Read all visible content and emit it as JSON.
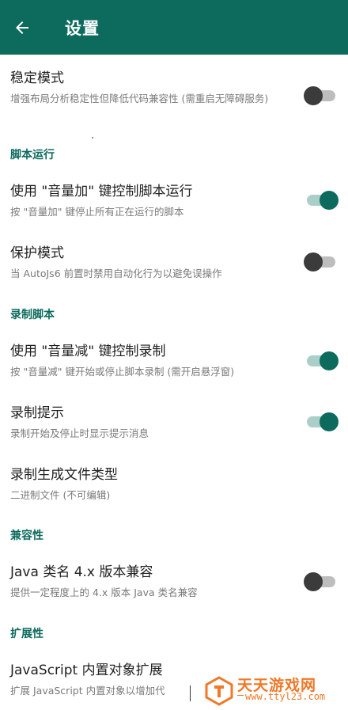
{
  "appbar": {
    "title": "设置",
    "back_icon": "arrow-left-icon",
    "color": "#0d6b5e"
  },
  "items": {
    "stable_mode": {
      "title": "稳定模式",
      "summary": "增强布局分析稳定性但降低代码兼容性 (需重启无障碍服务)",
      "checked": false
    },
    "cat_script_run": "脚本运行",
    "volume_up": {
      "title": "使用 \"音量加\" 键控制脚本运行",
      "summary": "按 \"音量加\" 键停止所有正在运行的脚本",
      "checked": true
    },
    "protect_mode": {
      "title": "保护模式",
      "summary": "当 AutoJs6 前置时禁用自动化行为以避免误操作",
      "checked": false
    },
    "cat_record": "录制脚本",
    "volume_down": {
      "title": "使用 \"音量减\" 键控制录制",
      "summary": "按 \"音量减\" 键开始或停止脚本录制 (需开启悬浮窗)",
      "checked": true
    },
    "record_tip": {
      "title": "录制提示",
      "summary": "录制开始及停止时显示提示消息",
      "checked": true
    },
    "record_file_type": {
      "title": "录制生成文件类型",
      "summary": "二进制文件 (不可编辑)"
    },
    "cat_compat": "兼容性",
    "java_compat": {
      "title": "Java 类名 4.x 版本兼容",
      "summary": "提供一定程度上的 4.x 版本 Java 类名兼容",
      "checked": false
    },
    "cat_ext": "扩展性",
    "js_ext": {
      "title": "JavaScript 内置对象扩展",
      "summary": "扩展 JavaScript 内置对象以增加代"
    }
  },
  "watermark": {
    "name": "天天游戏网",
    "url": "www.ttyl23.com",
    "color": "#f07828"
  }
}
